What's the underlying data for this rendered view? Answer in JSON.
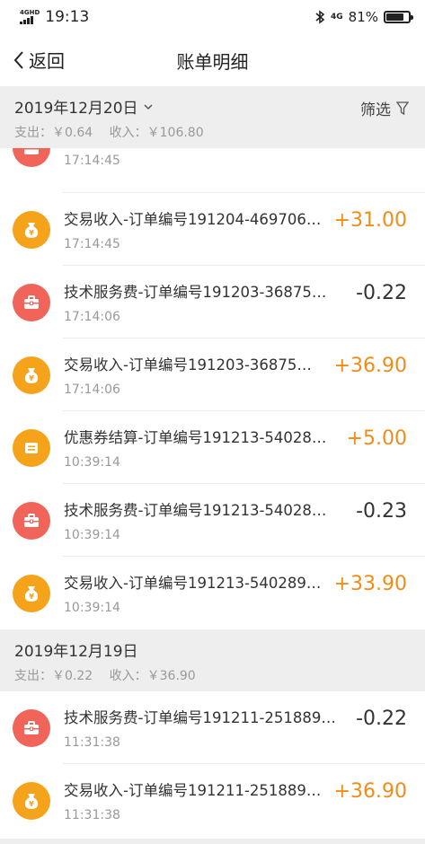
{
  "status_bar": {
    "network_tag": "4GHD",
    "time": "19:13",
    "network_4g": "4G",
    "battery": "81%",
    "battery_level": 0.81
  },
  "nav": {
    "back_label": "返回",
    "title": "账单明细"
  },
  "sections": [
    {
      "date": "2019年12月20日",
      "expense": "支出：￥0.64",
      "income": "收入：￥106.80",
      "filter_label": "筛选",
      "partial_time": "17:14:45",
      "rows": [
        {
          "type": "income",
          "title": "交易收入-订单编号191204-469706…",
          "time": "17:14:45",
          "amount": "+31.00"
        },
        {
          "type": "fee",
          "title": "技术服务费-订单编号191203-36875…",
          "time": "17:14:06",
          "amount": "-0.22"
        },
        {
          "type": "income",
          "title": "交易收入-订单编号191203-36875…",
          "time": "17:14:06",
          "amount": "+36.90"
        },
        {
          "type": "coupon",
          "title": "优惠券结算-订单编号191213-54028…",
          "time": "10:39:14",
          "amount": "+5.00"
        },
        {
          "type": "fee",
          "title": "技术服务费-订单编号191213-54028…",
          "time": "10:39:14",
          "amount": "-0.23"
        },
        {
          "type": "income",
          "title": "交易收入-订单编号191213-540289…",
          "time": "10:39:14",
          "amount": "+33.90"
        }
      ]
    },
    {
      "date": "2019年12月19日",
      "expense": "支出：￥0.22",
      "income": "收入：￥36.90",
      "rows": [
        {
          "type": "fee",
          "title": "技术服务费-订单编号191211-251889…",
          "time": "11:31:38",
          "amount": "-0.22"
        },
        {
          "type": "income",
          "title": "交易收入-订单编号191211-251889…",
          "time": "11:31:38",
          "amount": "+36.90"
        }
      ]
    }
  ],
  "colors": {
    "income_icon": "#f5a31b",
    "fee_icon": "#f0645a",
    "positive_amount": "#f08c1a",
    "section_bg": "#eeeeee"
  },
  "icons": {
    "income": "money-bag-icon",
    "fee": "toolbox-icon",
    "coupon": "coupon-icon"
  }
}
